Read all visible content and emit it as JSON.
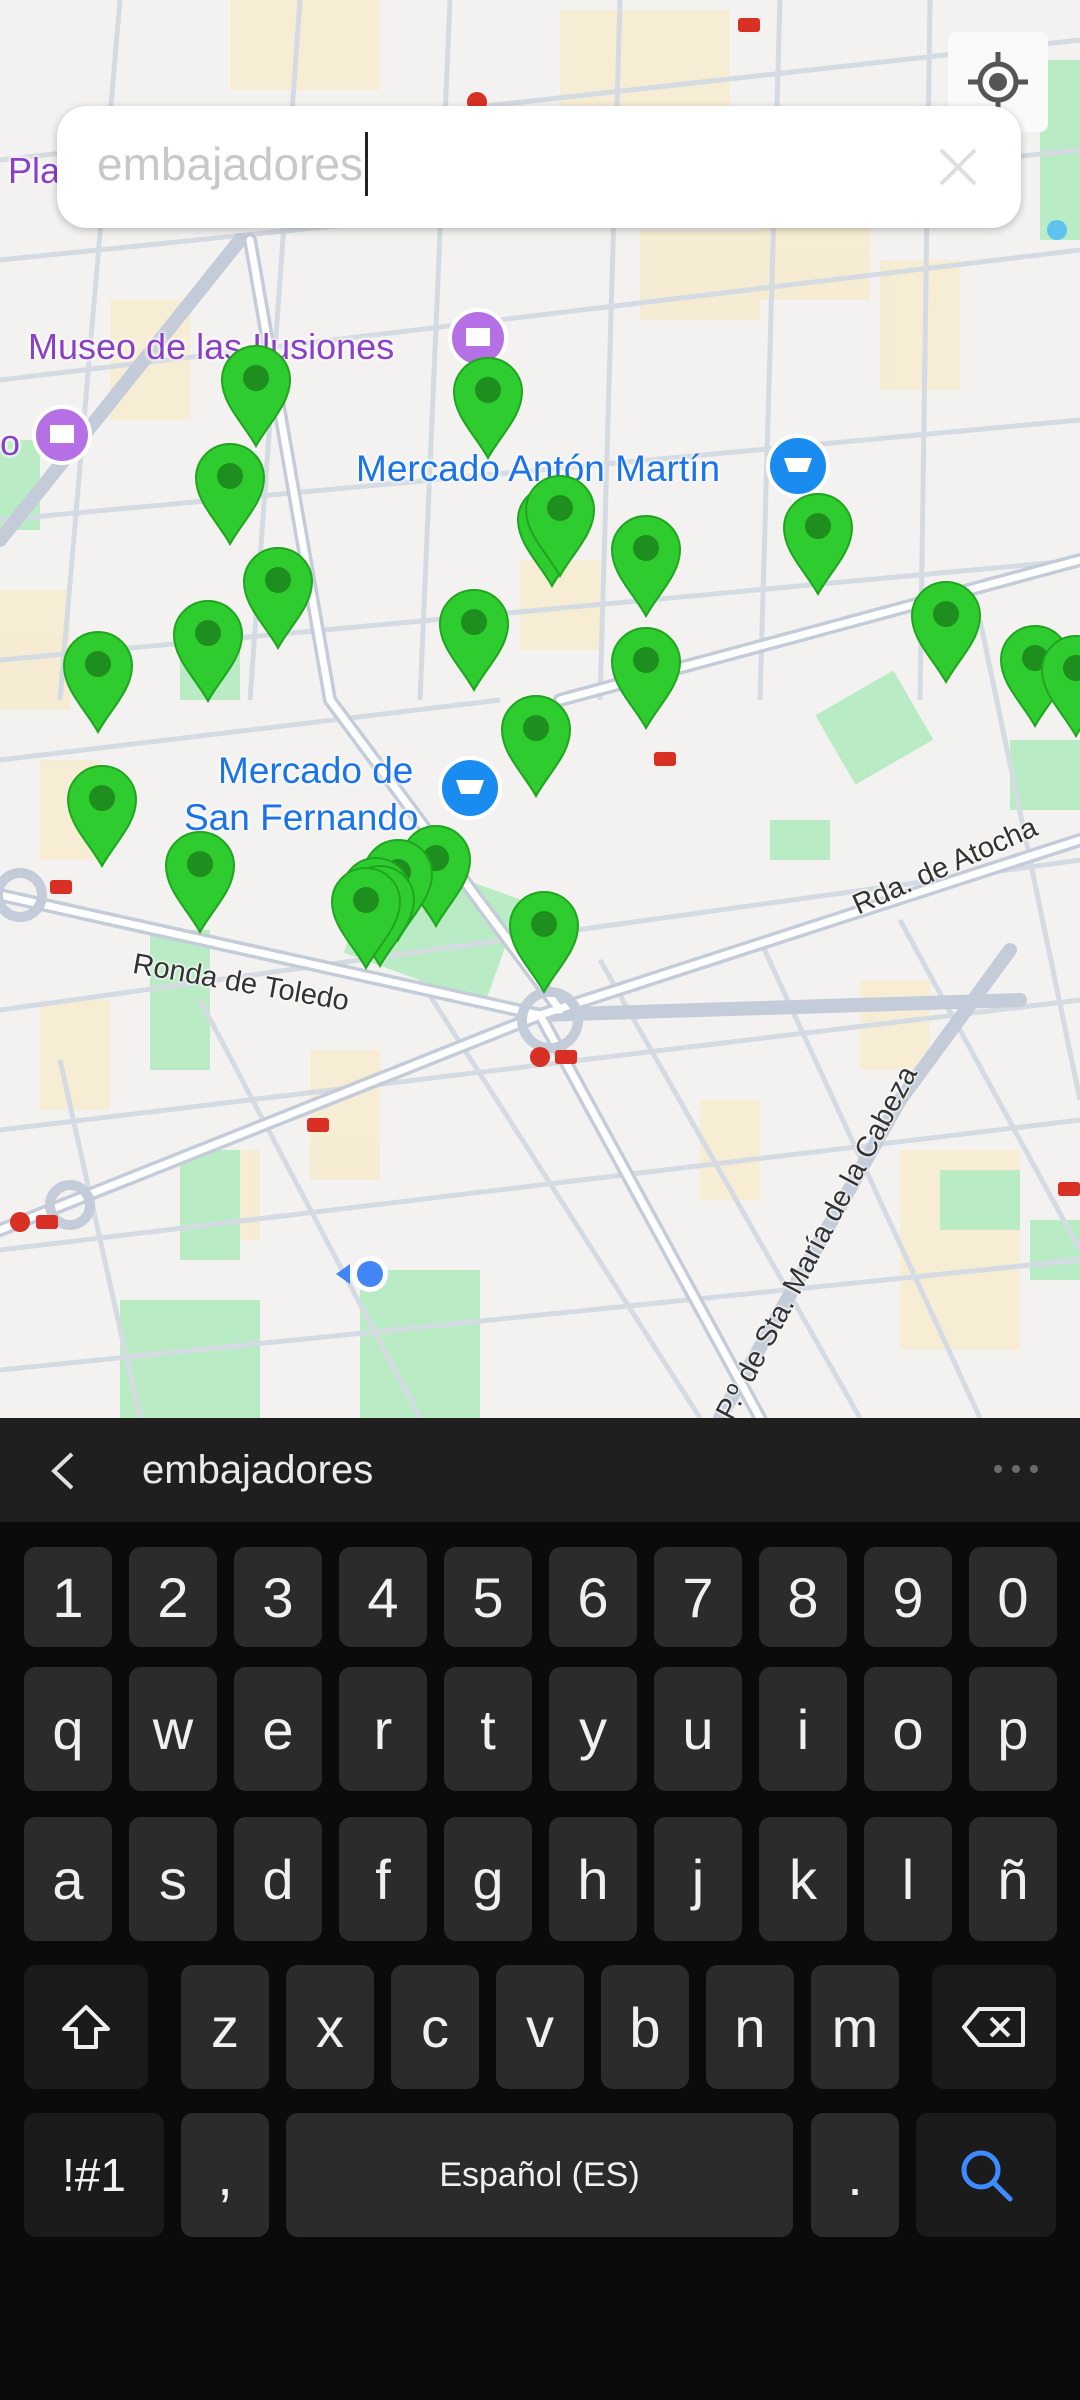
{
  "search": {
    "query": "embajadores"
  },
  "map": {
    "poi_labels": [
      {
        "text": "Museo de las Ilusiones",
        "kind": "museum"
      },
      {
        "text": "Mercado Antón Martín",
        "kind": "market"
      },
      {
        "text": "Mercado de",
        "kind": "market"
      },
      {
        "text": "San Fernando",
        "kind": "market"
      },
      {
        "text": "Pla",
        "kind": "partial"
      },
      {
        "text": "o",
        "kind": "partial"
      }
    ],
    "street_labels": [
      "Ronda de Toledo",
      "Rda. de Atocha",
      "P.º de Sta. María de la Cabeza"
    ],
    "pin_color": "#2ecc2e",
    "pin_count": 24
  },
  "suggestion_bar": {
    "word": "embajadores"
  },
  "keyboard": {
    "number_row": [
      "1",
      "2",
      "3",
      "4",
      "5",
      "6",
      "7",
      "8",
      "9",
      "0"
    ],
    "row1": [
      "q",
      "w",
      "e",
      "r",
      "t",
      "y",
      "u",
      "i",
      "o",
      "p"
    ],
    "row2": [
      "a",
      "s",
      "d",
      "f",
      "g",
      "h",
      "j",
      "k",
      "l",
      "ñ"
    ],
    "row3": [
      "z",
      "x",
      "c",
      "v",
      "b",
      "n",
      "m"
    ],
    "symbols_label": "!#1",
    "comma_label": ",",
    "space_label": "Español (ES)",
    "period_label": ".",
    "accent_color": "#3d8bff"
  }
}
